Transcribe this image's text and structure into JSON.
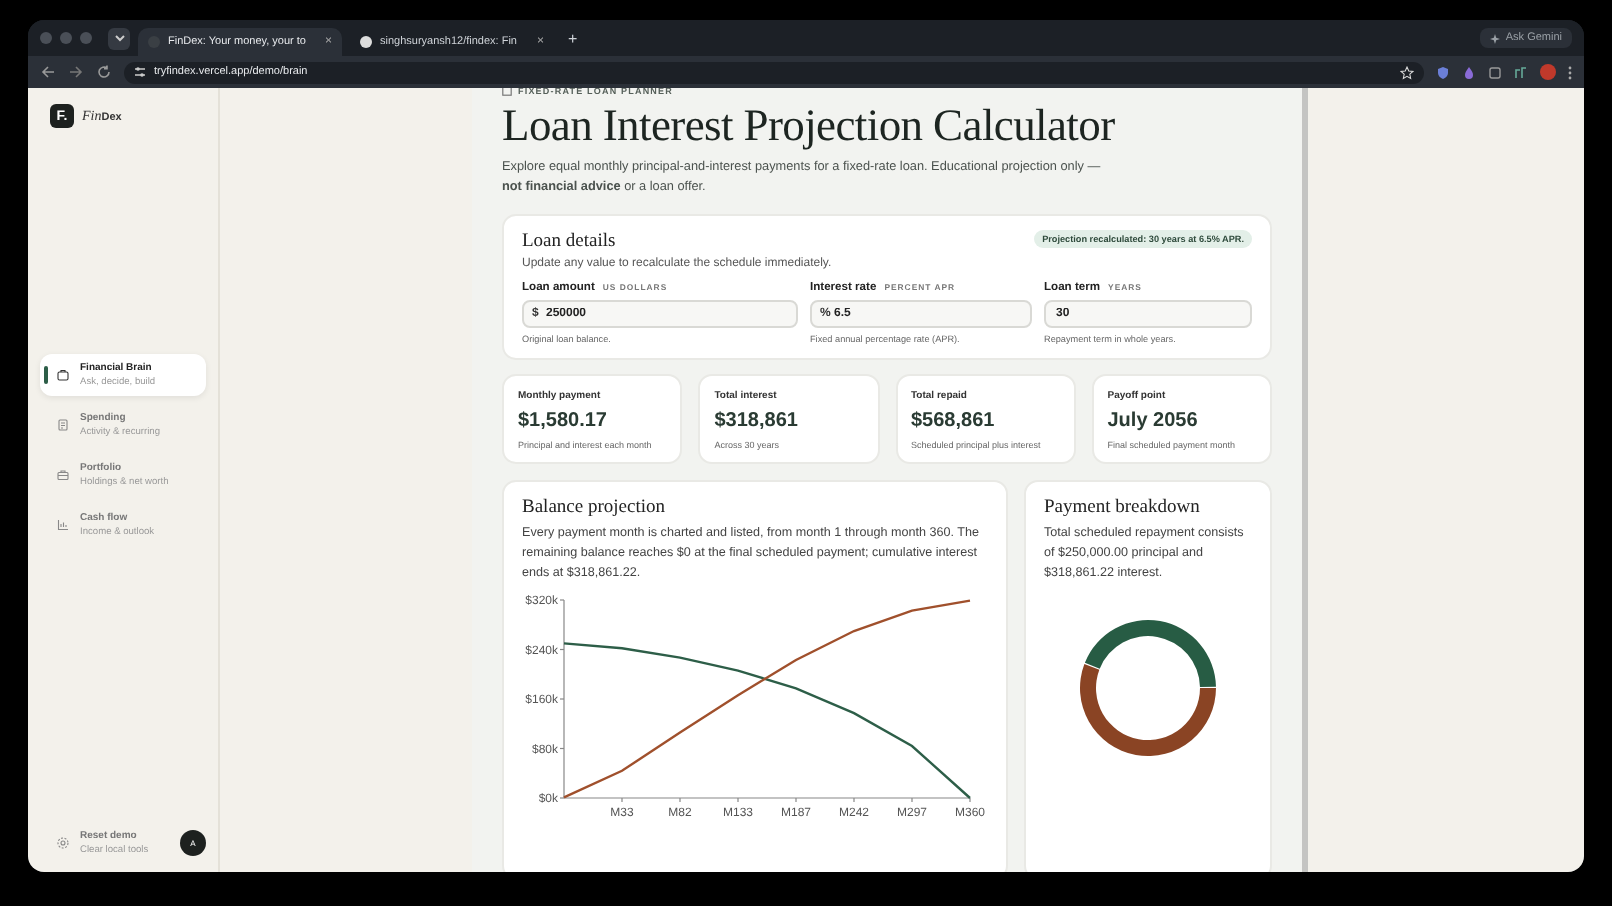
{
  "browser": {
    "tabs": [
      {
        "title": "FinDex: Your money, your to",
        "close": "×",
        "selected": true
      },
      {
        "title": "singhsuryansh12/findex: Fin",
        "close": "×",
        "selected": false
      }
    ],
    "new_tab": "+",
    "ask_button": "Ask Gemini",
    "url": "tryfindex.vercel.app/demo/brain"
  },
  "sidebar": {
    "logo_letter": "F.",
    "logo_text_italic": "Fin",
    "logo_text_bold": "Dex",
    "items": [
      {
        "label": "Financial Brain",
        "sub": "Ask, decide, build",
        "selected": true
      },
      {
        "label": "Spending",
        "sub": "Activity & recurring",
        "selected": false
      },
      {
        "label": "Portfolio",
        "sub": "Holdings & net worth",
        "selected": false
      },
      {
        "label": "Cash flow",
        "sub": "Income & outlook",
        "selected": false
      }
    ],
    "footer": {
      "label": "Reset demo",
      "sub": "Clear local tools",
      "avatar": "A"
    }
  },
  "page": {
    "eyebrow": "FIXED-RATE LOAN PLANNER",
    "title": "Loan Interest Projection Calculator",
    "description": "Explore equal monthly principal-and-interest payments for a fixed-rate loan. Educational projection only — **not financial advice** or a loan offer."
  },
  "loan_details": {
    "title": "Loan details",
    "subtitle": "Update any value to recalculate the schedule immediately.",
    "status": "Projection recalculated: 30 years at 6.5% APR.",
    "fields": [
      {
        "label": "Loan amount",
        "unit": "US DOLLARS",
        "prefix": "$",
        "value": "250000",
        "hint": "Original loan balance."
      },
      {
        "label": "Interest rate",
        "unit": "PERCENT APR",
        "prefix": "%",
        "value": "6.5",
        "hint": "Fixed annual percentage rate (APR)."
      },
      {
        "label": "Loan term",
        "unit": "YEARS",
        "value": "30",
        "hint": "Repayment term in whole years."
      }
    ]
  },
  "stats": [
    {
      "label": "Monthly payment",
      "value": "$1,580.17",
      "note": "Principal and interest each month"
    },
    {
      "label": "Total interest",
      "value": "$318,861",
      "note": "Across 30 years"
    },
    {
      "label": "Total repaid",
      "value": "$568,861",
      "note": "Scheduled principal plus interest"
    },
    {
      "label": "Payoff point",
      "value": "July 2056",
      "note": "Final scheduled payment month"
    }
  ],
  "balance_projection": {
    "title": "Balance projection",
    "description": "Every payment month is charted and listed, from month 1 through month 360. The remaining balance reaches $0 at the final scheduled payment; cumulative interest ends at $318,861.22.",
    "chart_data": {
      "type": "line",
      "categories": [
        null,
        "M33",
        "M82",
        "M133",
        "M187",
        "M242",
        "M297",
        "M360"
      ],
      "series": [
        {
          "color": "#2d5e48",
          "values": [
            250000,
            242000,
            227000,
            206000,
            177000,
            137000,
            84000,
            0
          ]
        },
        {
          "color": "#a0502c",
          "values": [
            1000,
            44000,
            106000,
            166000,
            223000,
            270000,
            303000,
            319000
          ]
        }
      ],
      "ylim": [
        0,
        320000
      ],
      "yticks": [
        {
          "value": 0,
          "label": "$0k"
        },
        {
          "value": 80000,
          "label": "$80k"
        },
        {
          "value": 160000,
          "label": "$160k"
        },
        {
          "value": 240000,
          "label": "$240k"
        },
        {
          "value": 320000,
          "label": "$320k"
        }
      ]
    }
  },
  "payment_breakdown": {
    "title": "Payment breakdown",
    "description": "Total scheduled repayment consists of $250,000.00 principal and $318,861.22 interest.",
    "chart_data": {
      "type": "donut",
      "values": [
        56.05,
        43.95
      ],
      "colors": [
        "#8a4424",
        "#275c44"
      ]
    }
  }
}
